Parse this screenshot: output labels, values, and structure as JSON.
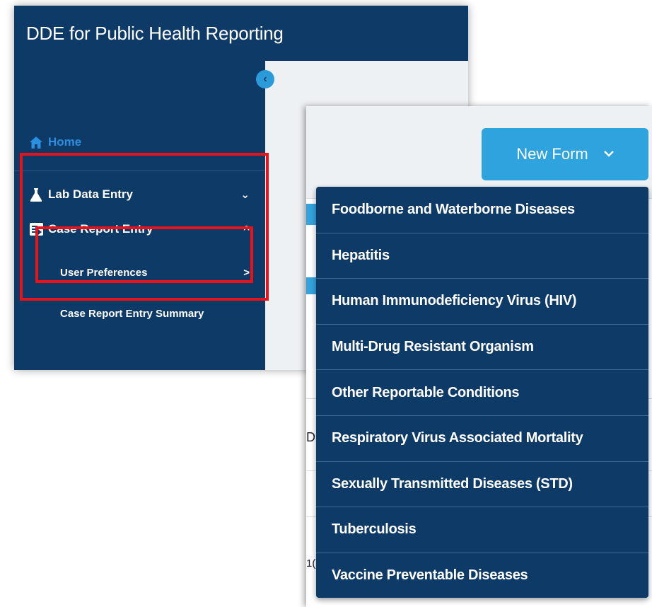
{
  "app": {
    "title": "DDE for Public Health Reporting"
  },
  "sidebar": {
    "items": [
      {
        "label": "Home",
        "icon": "home-icon"
      },
      {
        "label": "Lab Data Entry",
        "icon": "flask-icon",
        "chevron": "⌄"
      },
      {
        "label": "Case Report Entry",
        "icon": "case-report-icon",
        "chevron": "^"
      }
    ],
    "subitems": [
      {
        "label": "User Preferences",
        "chevron": ">"
      },
      {
        "label": "Case Report Entry Summary"
      }
    ],
    "collapse_icon": "chevron-left-icon"
  },
  "toolbar": {
    "new_form_label": "New Form"
  },
  "new_form_menu": [
    "Foodborne and Waterborne Diseases",
    "Hepatitis",
    "Human Immunodeficiency Virus (HIV)",
    "Multi-Drug Resistant Organism",
    "Other Reportable Conditions",
    "Respiratory Virus Associated Mortality",
    "Sexually Transmitted Diseases (STD)",
    "Tuberculosis",
    "Vaccine Preventable Diseases"
  ],
  "peek_text": {
    "d": "D",
    "num": "1("
  },
  "colors": {
    "nav_bg": "#0d3a66",
    "accent": "#2fa3de",
    "highlight": "#e8121b"
  }
}
